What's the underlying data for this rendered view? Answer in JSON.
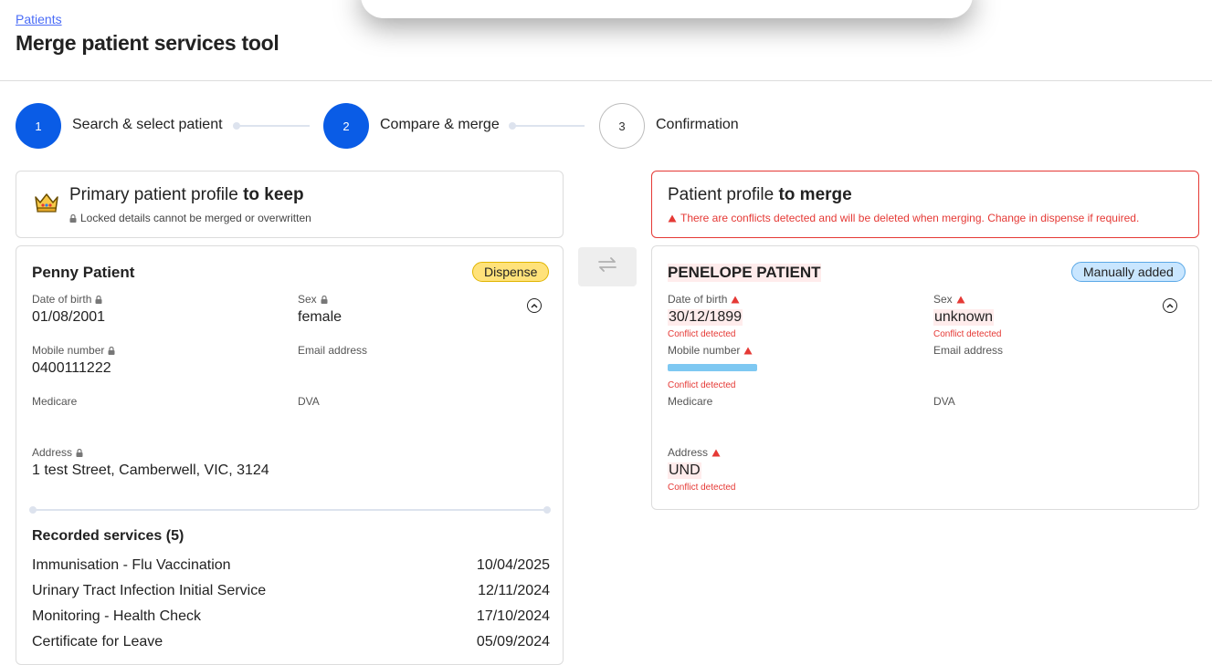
{
  "header": {
    "breadcrumb": "Patients",
    "title": "Merge patient services tool"
  },
  "stepper": {
    "steps": [
      {
        "number": "1",
        "label": "Search & select patient",
        "state": "complete"
      },
      {
        "number": "2",
        "label": "Compare & merge",
        "state": "active"
      },
      {
        "number": "3",
        "label": "Confirmation",
        "state": "pending"
      }
    ]
  },
  "primary": {
    "title_prefix": "Primary patient profile ",
    "title_strong": "to keep",
    "subtitle": "Locked details cannot be merged or overwritten",
    "name": "Penny Patient",
    "badge": "Dispense",
    "fields": {
      "dob_label": "Date of birth",
      "dob_value": "01/08/2001",
      "sex_label": "Sex",
      "sex_value": "female",
      "mobile_label": "Mobile number",
      "mobile_value": "0400111222",
      "email_label": "Email address",
      "medicare_label": "Medicare",
      "dva_label": "DVA",
      "address_label": "Address",
      "address_value": "1 test Street, Camberwell, VIC, 3124"
    },
    "services_title": "Recorded services (5)",
    "services": [
      {
        "name": "Immunisation - Flu Vaccination",
        "date": "10/04/2025"
      },
      {
        "name": "Urinary Tract Infection Initial Service",
        "date": "12/11/2024"
      },
      {
        "name": "Monitoring - Health Check",
        "date": "17/10/2024"
      },
      {
        "name": "Certificate for Leave",
        "date": "05/09/2024"
      }
    ]
  },
  "merge": {
    "title_prefix": "Patient profile ",
    "title_strong": "to merge",
    "subtitle": "There are conflicts detected and will be deleted when merging. Change in dispense if required.",
    "name": "PENELOPE PATIENT",
    "badge": "Manually added",
    "conflict_note": "Conflict detected",
    "fields": {
      "dob_label": "Date of birth",
      "dob_value": "30/12/1899",
      "sex_label": "Sex",
      "sex_value": "unknown",
      "mobile_label": "Mobile number",
      "email_label": "Email address",
      "medicare_label": "Medicare",
      "dva_label": "DVA",
      "address_label": "Address",
      "address_value": "UND"
    }
  },
  "colors": {
    "primary_blue": "#0a5ce6",
    "conflict_red": "#e53935",
    "dispense_badge": "#ffe27a",
    "manual_badge": "#c9e6ff"
  },
  "icons": {
    "crown": "crown-icon",
    "lock": "lock-icon",
    "warning": "warning-icon",
    "swap": "swap-arrows-icon",
    "collapse": "chevron-up-circle-icon"
  }
}
